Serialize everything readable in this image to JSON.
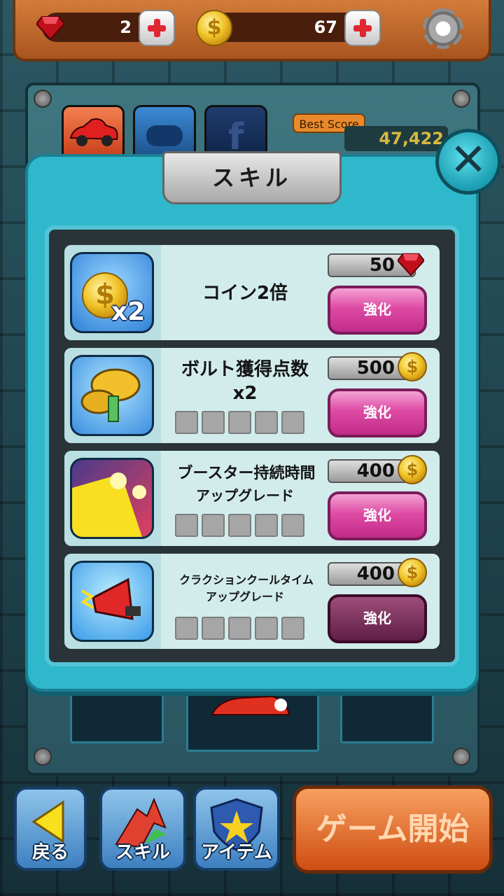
{
  "header": {
    "gems": "2",
    "coins": "67",
    "icons": {
      "gem": "ruby-gem-icon",
      "coin": "gold-coin-icon",
      "settings": "gear-icon",
      "plus": "plus-icon"
    }
  },
  "home": {
    "best_score_label": "Best Score",
    "best_score_value": "47,422",
    "tabs": [
      "car-tab",
      "gamepad-tab",
      "facebook-tab"
    ]
  },
  "skill_panel": {
    "title": "スキル",
    "close_icon": "close-x-icon",
    "skills": [
      {
        "name": "コイン2倍",
        "price": "50",
        "currency": "gem",
        "button": "強化",
        "levels": 0,
        "show_levels": false,
        "enabled": true
      },
      {
        "name": "ボルト獲得点数",
        "name2": "x2",
        "price": "500",
        "currency": "coin",
        "button": "強化",
        "levels": 5,
        "show_levels": true,
        "enabled": true
      },
      {
        "name": "ブースター持続時間",
        "name2": "アップグレード",
        "price": "400",
        "currency": "coin",
        "button": "強化",
        "levels": 5,
        "show_levels": true,
        "enabled": true
      },
      {
        "name": "クラクションクールタイム",
        "name2": "アップグレード",
        "price": "400",
        "currency": "coin",
        "button": "強化",
        "levels": 5,
        "show_levels": true,
        "enabled": false
      }
    ]
  },
  "bottom_bar": {
    "back": "戻る",
    "skill": "スキル",
    "item": "アイテム",
    "start": "ゲーム開始"
  },
  "colors": {
    "panel": "#2fb8cc",
    "upgrade_button": "#de4aa4",
    "start_button": "#cf4d12",
    "topbar": "#c26a2c"
  }
}
